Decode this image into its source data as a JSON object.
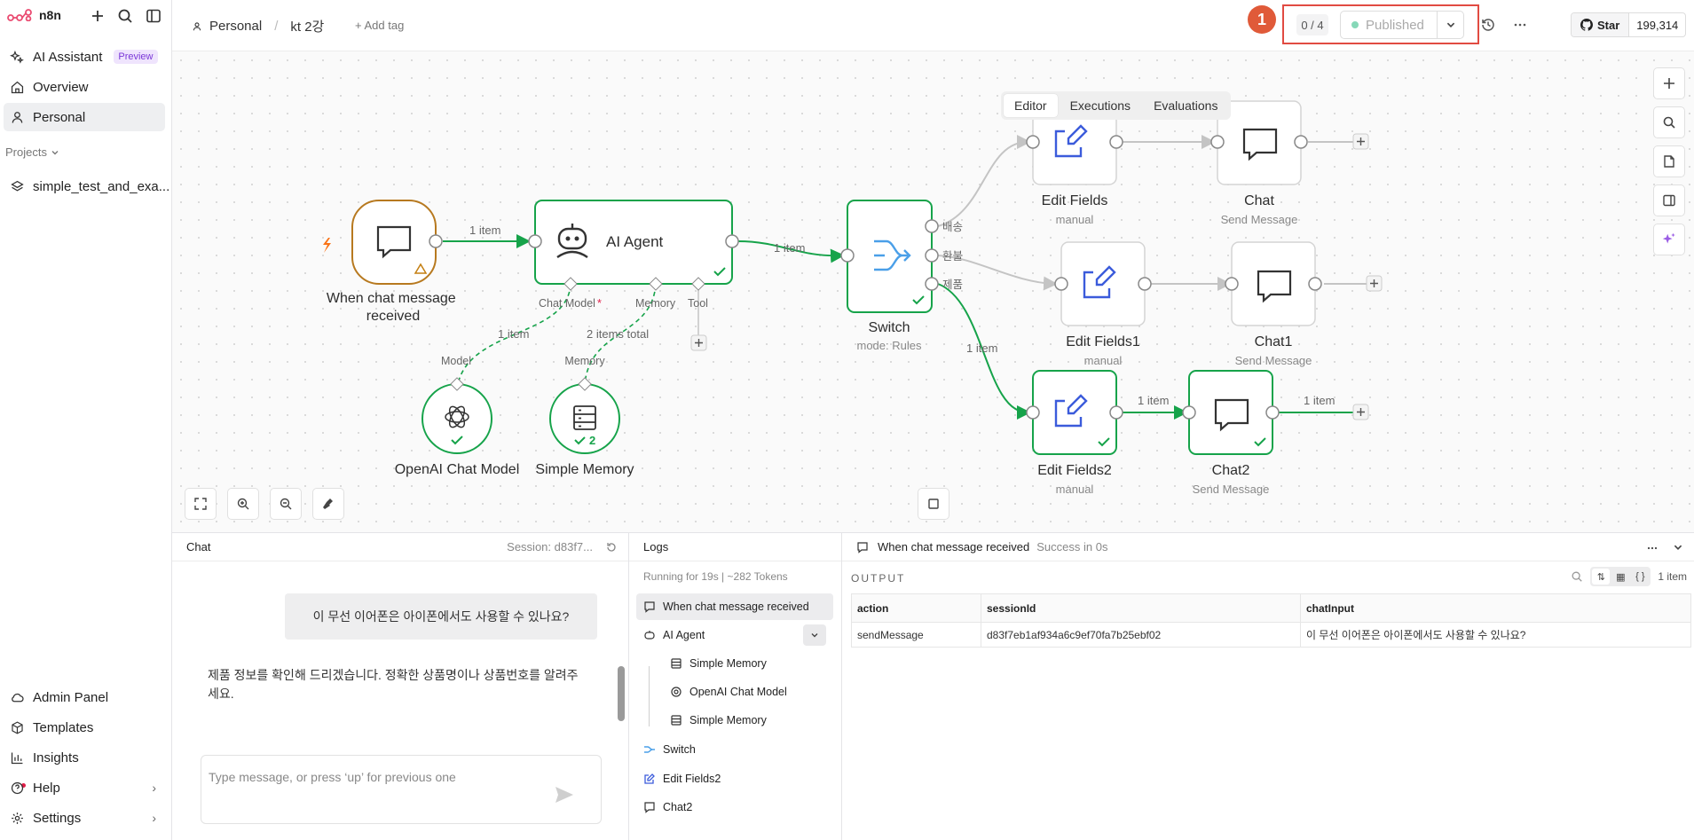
{
  "app": {
    "name": "n8n"
  },
  "sidebar": {
    "items": [
      {
        "label": "AI Assistant",
        "badge": "Preview"
      },
      {
        "label": "Overview"
      },
      {
        "label": "Personal"
      }
    ],
    "projects_label": "Projects",
    "projects": [
      {
        "label": "simple_test_and_exa..."
      }
    ],
    "bottom_items": [
      {
        "label": "Admin Panel"
      },
      {
        "label": "Templates"
      },
      {
        "label": "Insights"
      },
      {
        "label": "Help"
      },
      {
        "label": "Settings"
      }
    ]
  },
  "header": {
    "breadcrumb_project": "Personal",
    "workflow_name": "kt 2강",
    "add_tag": "+ Add tag",
    "step_badge": "1",
    "counter": "0 / 4",
    "publish_label": "Published",
    "github_star_label": "Star",
    "github_star_count": "199,314"
  },
  "canvas_tabs": [
    "Editor",
    "Executions",
    "Evaluations"
  ],
  "workflow": {
    "nodes": {
      "trigger": {
        "title": "When chat message received"
      },
      "agent": {
        "title": "AI Agent",
        "handle_chat_model": "Chat Model",
        "handle_memory": "Memory",
        "handle_tool": "Tool"
      },
      "openai": {
        "title": "OpenAI Chat Model",
        "handle": "Model"
      },
      "memory": {
        "title": "Simple Memory",
        "handle": "Memory",
        "count": "2"
      },
      "switch": {
        "title": "Switch",
        "subtitle": "mode: Rules",
        "out1": "배송",
        "out2": "환불",
        "out3": "제품"
      },
      "edit_fields": {
        "title": "Edit Fields",
        "subtitle": "manual"
      },
      "edit_fields1": {
        "title": "Edit Fields1",
        "subtitle": "manual"
      },
      "edit_fields2": {
        "title": "Edit Fields2",
        "subtitle": "manual"
      },
      "chat": {
        "title": "Chat",
        "subtitle": "Send Message"
      },
      "chat1": {
        "title": "Chat1",
        "subtitle": "Send Message"
      },
      "chat2": {
        "title": "Chat2",
        "subtitle": "Send Message"
      }
    },
    "edge_labels": {
      "trigger_agent": "1 item",
      "agent_switch": "1 item",
      "openai_agent": "1 item",
      "memory_agent": "2 items total",
      "switch_edit2": "1 item",
      "edit2_chat2": "1 item",
      "chat2_out": "1 item"
    }
  },
  "chat_panel": {
    "title": "Chat",
    "session": "Session: d83f7...",
    "user_message": "이 무선 이어폰은 아이폰에서도 사용할 수 있나요?",
    "bot_message": "제품 정보를 확인해 드리겠습니다. 정확한 상품명이나 상품번호를 알려주세요.",
    "input_placeholder": "Type message, or press ‘up’ for previous one"
  },
  "logs_panel": {
    "title": "Logs",
    "meta": "Running for 19s  |  ~282 Tokens",
    "entries": [
      {
        "label": "When chat message received"
      },
      {
        "label": "AI Agent"
      },
      {
        "label": "Simple Memory"
      },
      {
        "label": "OpenAI Chat Model"
      },
      {
        "label": "Simple Memory"
      },
      {
        "label": "Switch"
      },
      {
        "label": "Edit Fields2"
      },
      {
        "label": "Chat2"
      }
    ]
  },
  "output_panel": {
    "title": "When chat message received",
    "status": "Success in 0s",
    "section_label": "OUTPUT",
    "item_count": "1 item",
    "columns": [
      "action",
      "sessionId",
      "chatInput"
    ],
    "rows": [
      [
        "sendMessage",
        "d83f7eb1af934a6c9ef70fa7b25ebf02",
        "이 무선 이어폰은 아이폰에서도 사용할 수 있나요?"
      ]
    ]
  },
  "colors": {
    "success": "#16a34a",
    "trigger_border": "#b7791f",
    "accent": "#7b38d8",
    "publish_highlight": "#e14b42",
    "badge": "#e05a39"
  }
}
